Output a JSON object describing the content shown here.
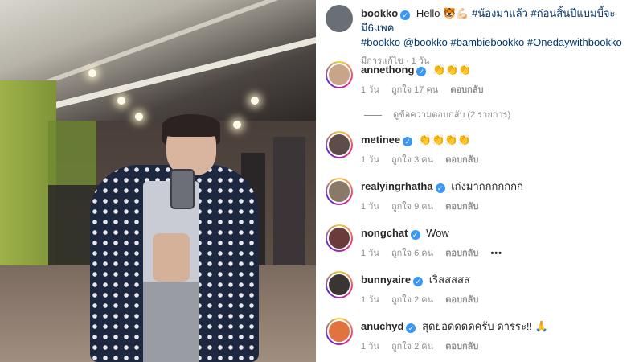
{
  "post": {
    "author": "bookko",
    "caption_text": "Hello",
    "caption_emoji": "🐯💪🏻",
    "hashtags_line1": "#น้องมาแล้ว #ก่อนสิ้นปีแบมบี้จะมี6แพค",
    "hashtags_line2": "#bookko @bookko #bambiebookko #Onedaywithbookko",
    "edited_label": "มีการแก้ไข · 1 วัน"
  },
  "view_replies": "ดูข้อความตอบกลับ (2 รายการ)",
  "comments": [
    {
      "username": "annethong",
      "text": "👏👏👏",
      "time": "1 วัน",
      "likes": "ถูกใจ 17 คน",
      "reply": "ตอบกลับ"
    },
    {
      "username": "metinee",
      "text": "👏👏👏👏",
      "time": "1 วัน",
      "likes": "ถูกใจ 3 คน",
      "reply": "ตอบกลับ"
    },
    {
      "username": "realyingrhatha",
      "text": "เก่งมากกกกกกก",
      "time": "1 วัน",
      "likes": "ถูกใจ 9 คน",
      "reply": "ตอบกลับ"
    },
    {
      "username": "nongchat",
      "text": "Wow",
      "time": "1 วัน",
      "likes": "ถูกใจ 6 คน",
      "reply": "ตอบกลับ",
      "more": "•••"
    },
    {
      "username": "bunnyaire",
      "text": "เริสสสสส",
      "time": "1 วัน",
      "likes": "ถูกใจ 2 คน",
      "reply": "ตอบกลับ"
    },
    {
      "username": "anuchyd",
      "text": "สุดยอดดดดครับ ดารระ!! 🙏",
      "time": "1 วัน",
      "likes": "ถูกใจ 2 คน",
      "reply": "ตอบกลับ"
    }
  ],
  "colors": {
    "verified": "#3897f0",
    "hashtag": "#00376b",
    "meta": "#8e8e8e"
  }
}
